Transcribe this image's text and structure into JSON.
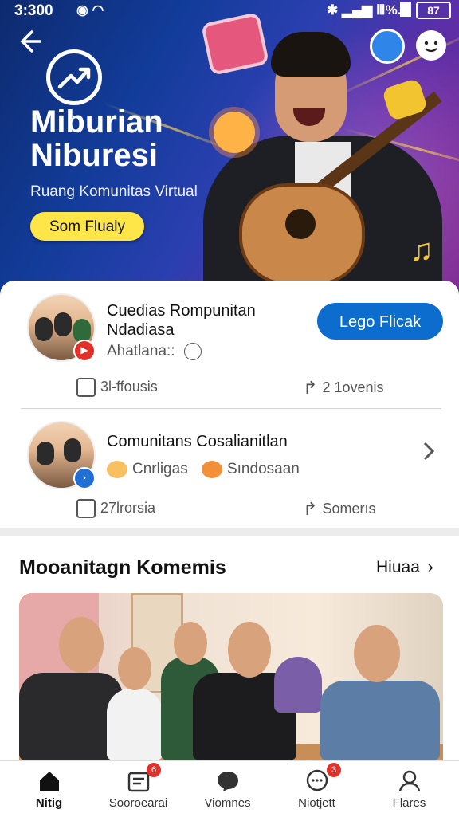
{
  "status_bar": {
    "time": "3:300",
    "battery": "87"
  },
  "hero": {
    "title_line1": "Miburian",
    "title_line2": "Niburesi",
    "subtitle": "Ruang Komunitas Virtual",
    "button_label": "Som Flualy"
  },
  "communities": [
    {
      "title_line1": "Cuedias Rompunitan",
      "title_line2": "Ndadiasa",
      "subtitle": "Ahatlana::",
      "action_label": "Lego Flicak",
      "stat_left": "3l-ffousis",
      "stat_right": "2 1ovenis"
    },
    {
      "title_line1": "Comunitans Cosalianitlan",
      "tag1": "Cnrligas",
      "tag2": "Sındosaan",
      "stat_left": "27lrorsia",
      "stat_right": "Somerıs"
    }
  ],
  "section": {
    "title": "Mooanitagn Komemis",
    "link_label": "Hiuaa"
  },
  "nav": [
    {
      "label": "Nitig",
      "badge": ""
    },
    {
      "label": "Sooroearai",
      "badge": "6"
    },
    {
      "label": "Viomnes",
      "badge": ""
    },
    {
      "label": "Niotjett",
      "badge": "3"
    },
    {
      "label": "Flares",
      "badge": ""
    }
  ],
  "colors": {
    "accent_blue": "#0c6dcf",
    "hero_button": "#ffe648",
    "badge_red": "#e2302a"
  }
}
